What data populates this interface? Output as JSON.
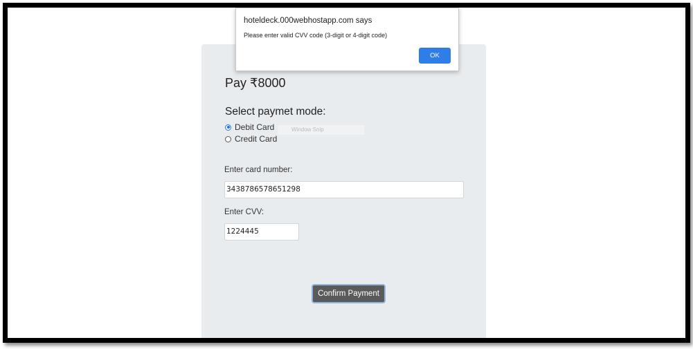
{
  "dialog": {
    "title": "hoteldeck.000webhostapp.com says",
    "message": "Please enter valid CVV code (3-digit or 4-digit code)",
    "ok_label": "OK"
  },
  "payment": {
    "amount_text": "Pay ₹8000",
    "mode_heading": "Select paymet mode:",
    "modes": [
      {
        "label": "Debit Card",
        "checked": true
      },
      {
        "label": "Credit Card",
        "checked": false
      }
    ],
    "card_label": "Enter card number:",
    "card_value": "3438786578651298",
    "cvv_label": "Enter CVV:",
    "cvv_value": "1224445",
    "confirm_label": "Confirm Payment"
  },
  "overlay": {
    "snip_hint": "Window Snip"
  },
  "colors": {
    "panel_bg": "#e9ecef",
    "ok_button": "#2f7ee8",
    "confirm_button": "#5a5a5a",
    "radio_checked": "#1a73e8"
  },
  "icons": {
    "radio_checked": "radio-checked-icon",
    "radio_unchecked": "radio-unchecked-icon"
  }
}
